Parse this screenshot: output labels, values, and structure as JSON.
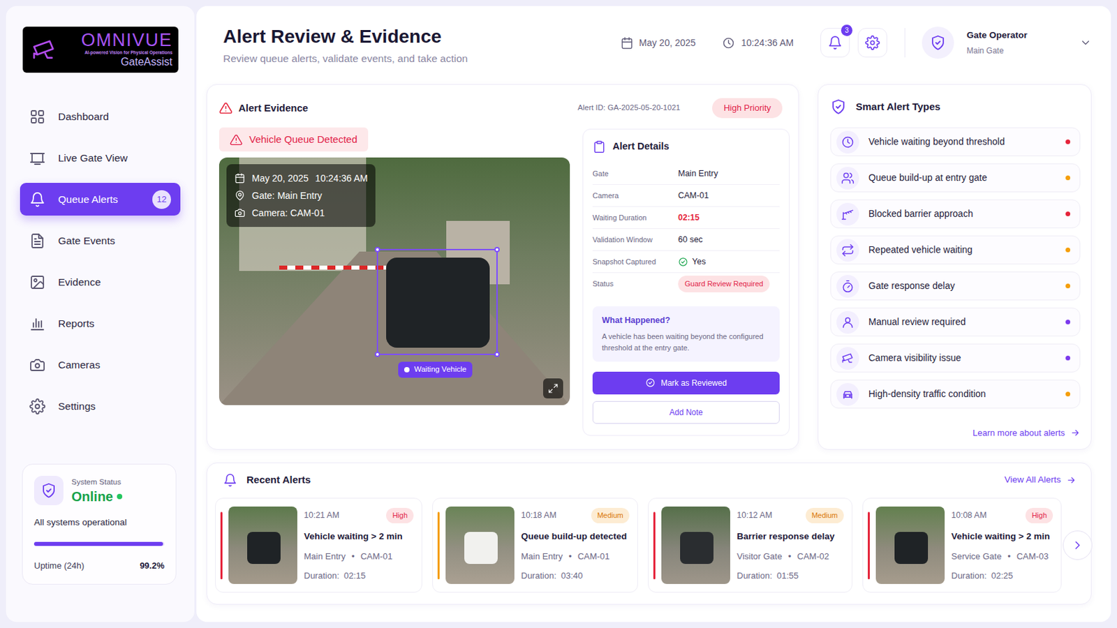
{
  "brand": {
    "name": "OMNIVUE",
    "tagline": "AI-powered Vision for Physical Operations",
    "product": "GateAssist"
  },
  "sidebar": {
    "items": [
      {
        "label": "Dashboard",
        "selected": false
      },
      {
        "label": "Live Gate View",
        "selected": false
      },
      {
        "label": "Queue Alerts",
        "selected": true,
        "badge": "12"
      },
      {
        "label": "Gate Events",
        "selected": false
      },
      {
        "label": "Evidence",
        "selected": false
      },
      {
        "label": "Reports",
        "selected": false
      },
      {
        "label": "Cameras",
        "selected": false
      },
      {
        "label": "Settings",
        "selected": false
      }
    ]
  },
  "system_status": {
    "label": "System Status",
    "value": "Online",
    "online": true,
    "message": "All systems operational",
    "uptime_label": "Uptime (24h)",
    "uptime": "99.2%",
    "level": 0.992
  },
  "header": {
    "title": "Alert Review & Evidence",
    "subtitle": "Review queue alerts, validate events, and take action",
    "date": "May 20, 2025",
    "time": "10:24:36 AM",
    "notifications": "3",
    "user": {
      "name": "Gate Operator",
      "location": "Main Gate"
    }
  },
  "evidence": {
    "title": "Alert Evidence",
    "alert_id": "Alert ID: GA-2025-05-20-1021",
    "priority": "High Priority",
    "event": "Vehicle Queue Detected",
    "overlay": {
      "date": "May 20, 2025",
      "time": "10:24:36 AM",
      "gate": "Gate: Main Entry",
      "camera": "Camera: CAM-01"
    },
    "detection": "Waiting Vehicle"
  },
  "details": {
    "title": "Alert Details",
    "rows": [
      {
        "label": "Gate",
        "value": "Main Entry",
        "kind": "text"
      },
      {
        "label": "Camera",
        "value": "CAM-01",
        "kind": "text"
      },
      {
        "label": "Waiting Duration",
        "value": "02:15",
        "kind": "alert"
      },
      {
        "label": "Validation Window",
        "value": "60 sec",
        "kind": "text"
      },
      {
        "label": "Snapshot Captured",
        "value": "Yes",
        "kind": "check"
      },
      {
        "label": "Status",
        "value": "Guard Review Required",
        "kind": "badge"
      }
    ],
    "what_title": "What Happened?",
    "what_text": "A vehicle has been waiting beyond the configured threshold at the entry gate.",
    "buttons": [
      "Mark as Reviewed",
      "Add Note"
    ]
  },
  "alert_types": {
    "title": "Smart Alert Types",
    "items": [
      {
        "label": "Vehicle waiting beyond threshold",
        "color": "#e5243b"
      },
      {
        "label": "Queue build-up at entry gate",
        "color": "#f59e0b"
      },
      {
        "label": "Blocked barrier approach",
        "color": "#e5243b"
      },
      {
        "label": "Repeated vehicle waiting",
        "color": "#f59e0b"
      },
      {
        "label": "Gate response delay",
        "color": "#f59e0b"
      },
      {
        "label": "Manual review required",
        "color": "#7c3aed"
      },
      {
        "label": "Camera visibility issue",
        "color": "#7c3aed"
      },
      {
        "label": "High-density traffic condition",
        "color": "#f59e0b"
      }
    ],
    "link": "Learn more about alerts"
  },
  "recent": {
    "title": "Recent Alerts",
    "link": "View All Alerts",
    "separator": "•",
    "duration_label": "Duration:",
    "items": [
      {
        "time": "10:21 AM",
        "priority": "High",
        "kind": "high",
        "color": "#e5243b",
        "title": "Vehicle waiting > 2 min",
        "gate": "Main Entry",
        "camera": "CAM-01",
        "duration": "02:15"
      },
      {
        "time": "10:18 AM",
        "priority": "Medium",
        "kind": "medium",
        "color": "#f59e0b",
        "title": "Queue build-up detected",
        "gate": "Main Entry",
        "camera": "CAM-01",
        "duration": "03:40"
      },
      {
        "time": "10:12 AM",
        "priority": "Medium",
        "kind": "medium",
        "color": "#e5243b",
        "title": "Barrier response delay",
        "gate": "Visitor Gate",
        "camera": "CAM-02",
        "duration": "01:55"
      },
      {
        "time": "10:08 AM",
        "priority": "High",
        "kind": "high",
        "color": "#e5243b",
        "title": "Vehicle waiting > 2 min",
        "gate": "Service Gate",
        "camera": "CAM-03",
        "duration": "02:25"
      }
    ]
  }
}
